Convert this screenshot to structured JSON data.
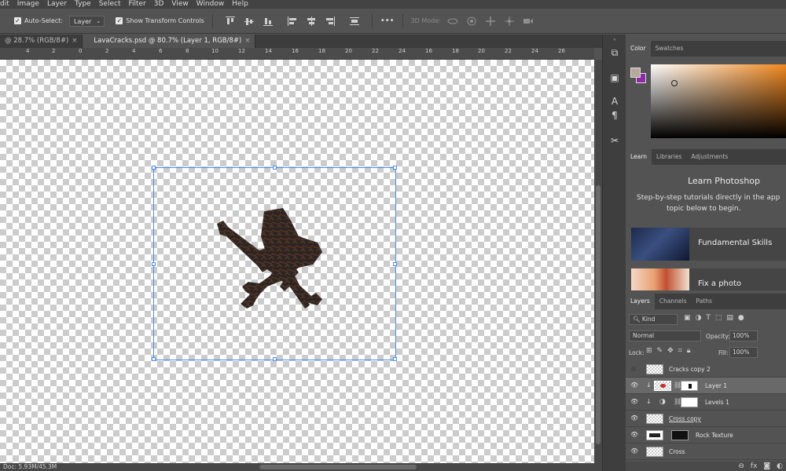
{
  "menu": [
    "dit",
    "Image",
    "Layer",
    "Type",
    "Select",
    "Filter",
    "3D",
    "View",
    "Window",
    "Help"
  ],
  "options": {
    "auto_select_label": "Auto-Select:",
    "auto_select_value": "Layer",
    "show_transform_label": "Show Transform Controls",
    "mode_3d_label": "3D Mode:",
    "more_label": "•••"
  },
  "tabs": [
    {
      "label": "@ 28.7% (RGB/8#)",
      "close": "×"
    },
    {
      "label": "LavaCracks.psd @ 80.7% (Layer 1, RGB/8#)",
      "close": "×"
    }
  ],
  "ruler_ticks": [
    "4",
    "2",
    "0",
    "2",
    "4",
    "6",
    "8",
    "10",
    "12",
    "14",
    "16",
    "18",
    "20",
    "22",
    "24"
  ],
  "status": {
    "doc": "Doc: 5.93M/45.3M"
  },
  "color_panel": {
    "tabs": [
      "Color",
      "Swatches"
    ],
    "foreground": "#b6a89a",
    "background": "#8c2aa8",
    "hue": "#f08820"
  },
  "learn_panel": {
    "tabs": [
      "Learn",
      "Libraries",
      "Adjustments"
    ],
    "title": "Learn Photoshop",
    "subtitle_line1": "Step-by-step tutorials directly in the app",
    "subtitle_line2": "topic below to begin.",
    "cards": [
      "Fundamental Skills",
      "Fix a photo"
    ]
  },
  "layers_panel": {
    "tabs": [
      "Layers",
      "Channels",
      "Paths"
    ],
    "filter_kind": "Kind",
    "blend_mode": "Normal",
    "opacity_label": "Opacity:",
    "opacity_value": "100%",
    "lock_label": "Lock:",
    "fill_label": "Fill:",
    "fill_value": "100%",
    "layers": [
      {
        "name": "Cracks copy 2",
        "visible": false,
        "selected": false
      },
      {
        "name": "Layer 1",
        "visible": true,
        "selected": true
      },
      {
        "name": "Levels 1",
        "visible": true,
        "selected": false
      },
      {
        "name": "Cross copy",
        "visible": true,
        "selected": false
      },
      {
        "name": "Rock Texture",
        "visible": true,
        "selected": false
      },
      {
        "name": "Cross",
        "visible": true,
        "selected": false
      }
    ],
    "footer_icons": [
      "link-icon",
      "fx-icon",
      "mask-icon",
      "adjustment-icon"
    ]
  }
}
